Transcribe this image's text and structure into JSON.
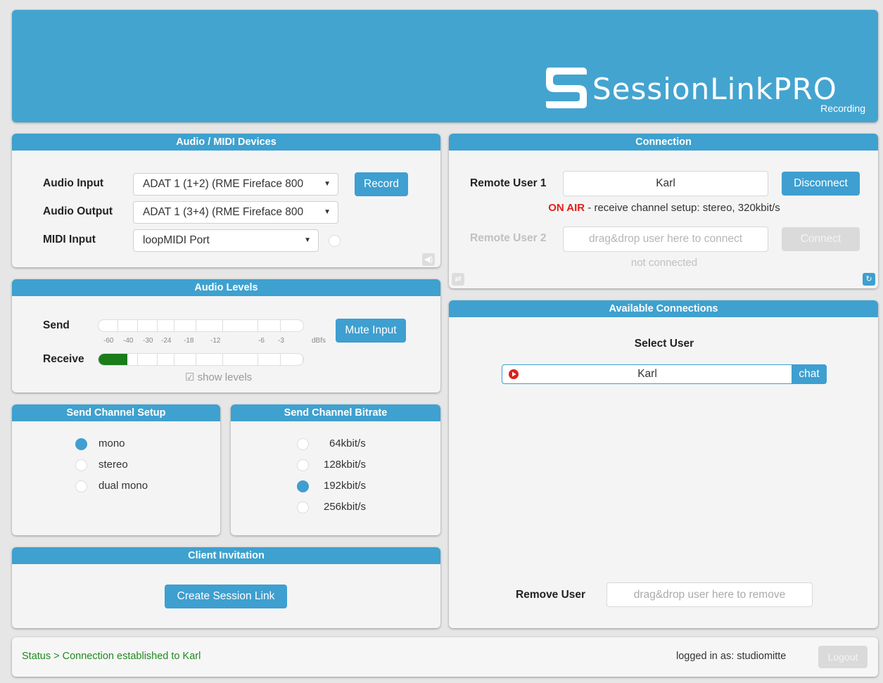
{
  "app": {
    "logo_text": "SessionLinkPRO",
    "logo_sub": "Recording"
  },
  "devices": {
    "title": "Audio / MIDI Devices",
    "audio_input_label": "Audio Input",
    "audio_input_value": "ADAT 1 (1+2) (RME Fireface 800",
    "record_label": "Record",
    "audio_output_label": "Audio Output",
    "audio_output_value": "ADAT 1 (3+4) (RME Fireface 800",
    "midi_input_label": "MIDI Input",
    "midi_input_value": "loopMIDI Port"
  },
  "levels": {
    "title": "Audio Levels",
    "send_label": "Send",
    "receive_label": "Receive",
    "mute_label": "Mute Input",
    "ticks": [
      "-60",
      "-40",
      "-30",
      "-24",
      "-18",
      "-12",
      "-6",
      "-3",
      "dBfs"
    ],
    "send_level": 0,
    "receive_level": 0.14,
    "show_levels_label": "show levels",
    "show_levels_checked": true
  },
  "channel_setup": {
    "title": "Send Channel Setup",
    "options": [
      {
        "label": "mono",
        "selected": true
      },
      {
        "label": "stereo",
        "selected": false
      },
      {
        "label": "dual mono",
        "selected": false
      }
    ]
  },
  "bitrate": {
    "title": "Send Channel Bitrate",
    "options": [
      {
        "label": "64kbit/s",
        "selected": false
      },
      {
        "label": "128kbit/s",
        "selected": false
      },
      {
        "label": "192kbit/s",
        "selected": true
      },
      {
        "label": "256kbit/s",
        "selected": false
      }
    ]
  },
  "invitation": {
    "title": "Client Invitation",
    "create_label": "Create Session Link"
  },
  "connection": {
    "title": "Connection",
    "user1_label": "Remote User 1",
    "user1_value": "Karl",
    "disconnect_label": "Disconnect",
    "on_air_label": "ON AIR",
    "user1_status": " - receive channel setup: stereo, 320kbit/s",
    "user2_label": "Remote User 2",
    "user2_placeholder": "drag&drop user here to connect",
    "connect_label": "Connect",
    "user2_status": "not connected"
  },
  "available": {
    "title": "Available Connections",
    "select_user_label": "Select User",
    "users": [
      {
        "name": "Karl",
        "chat_label": "chat"
      }
    ],
    "remove_user_label": "Remove User",
    "remove_placeholder": "drag&drop user here to remove"
  },
  "statusbar": {
    "status_text": "Status > Connection established to Karl",
    "logged_in_text": "logged in as: studiomitte",
    "logout_label": "Logout"
  },
  "colors": {
    "accent": "#3e9fd0",
    "on_air": "#e0201b",
    "status_green": "#1f8a1f",
    "meter_green": "#1a7d1a"
  }
}
